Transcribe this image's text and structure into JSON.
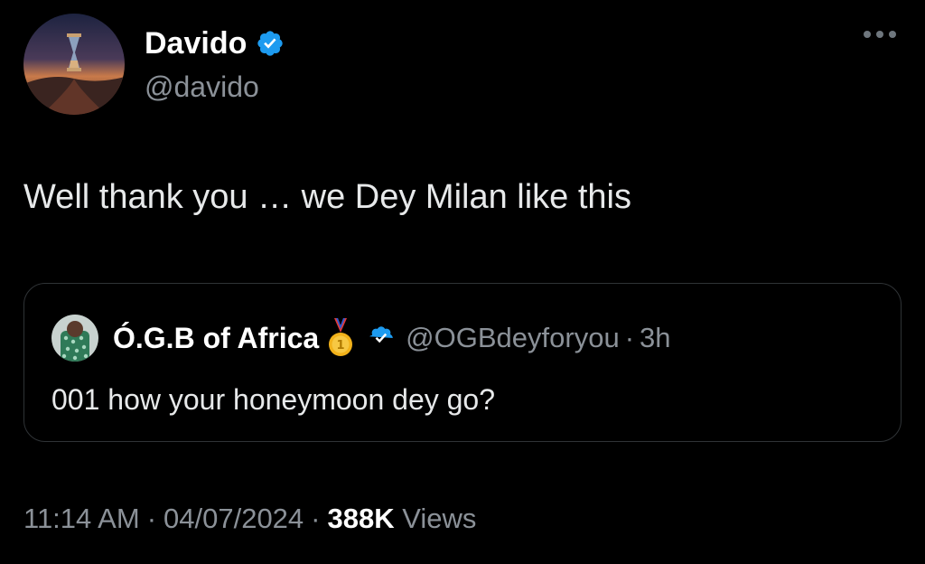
{
  "author": {
    "display_name": "Davido",
    "handle": "@davido",
    "verified": true
  },
  "tweet": {
    "text": "Well thank you … we Dey Milan like this"
  },
  "quoted_tweet": {
    "display_name": "Ó.G.B of Africa",
    "handle": "@OGBdeyforyou",
    "separator": "·",
    "time": "3h",
    "text": "001 how your honeymoon dey go?",
    "verified": true,
    "badge_icon": "gold-medal-icon"
  },
  "meta": {
    "time": "11:14 AM",
    "separator": "·",
    "date": "04/07/2024",
    "views_count": "388K",
    "views_label": "Views"
  },
  "colors": {
    "background": "#000000",
    "text_primary": "#e7e9ea",
    "text_secondary": "#8b9198",
    "verified_blue": "#1d9bf0",
    "border": "#2f3336"
  }
}
